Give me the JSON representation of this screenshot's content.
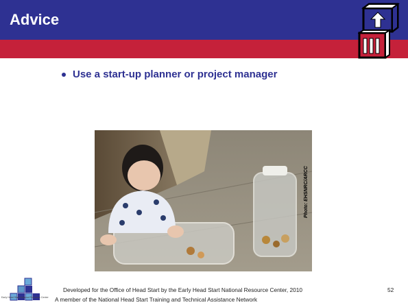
{
  "slide": {
    "title": "Advice",
    "bullets": [
      {
        "text": "Use a start-up planner or project manager"
      }
    ],
    "photo": {
      "alt": "Baby crawling on floor beside clear plastic containers",
      "credit": "Photo: EHSNRC/ARCC"
    },
    "footer": {
      "line1": "Developed for the Office of Head Start by the Early Head Start National Resource Center, 2010",
      "line2": "A member of the National Head Start Training and Technical Assistance Network",
      "logo_caption": "Early Head Start National Resource Center",
      "page_number": "52"
    },
    "colors": {
      "header": "#2e3192",
      "accent": "#c5213a",
      "bullet_text": "#2e3192"
    }
  }
}
